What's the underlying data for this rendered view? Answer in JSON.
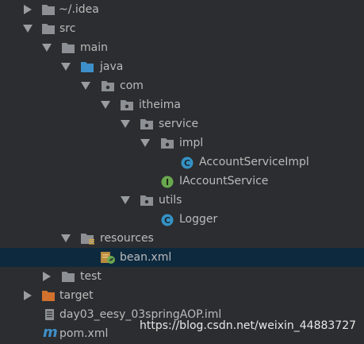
{
  "tree": {
    "idea": "~/.idea",
    "src": "src",
    "main": "main",
    "java": "java",
    "com": "com",
    "itheima": "itheima",
    "service": "service",
    "impl": "impl",
    "account_service_impl": "AccountServiceImpl",
    "iaccount_service": "IAccountService",
    "utils": "utils",
    "logger": "Logger",
    "resources": "resources",
    "bean_xml": "bean.xml",
    "test": "test",
    "target": "target",
    "iml": "day03_eesy_03springAOP.iml",
    "pom": "pom.xml"
  },
  "icons": {
    "class_letter": "C",
    "interface_letter": "I",
    "maven_letter": "m"
  },
  "colors": {
    "background": "#2b2d30",
    "selected_row": "#0d293e",
    "folder_grey": "#8c8f93",
    "folder_blue": "#3d8fc9",
    "folder_orange": "#d2712d",
    "class_icon": "#3592c4",
    "interface_icon": "#6aa84f"
  },
  "watermark": "https://blog.csdn.net/weixin_44883727"
}
